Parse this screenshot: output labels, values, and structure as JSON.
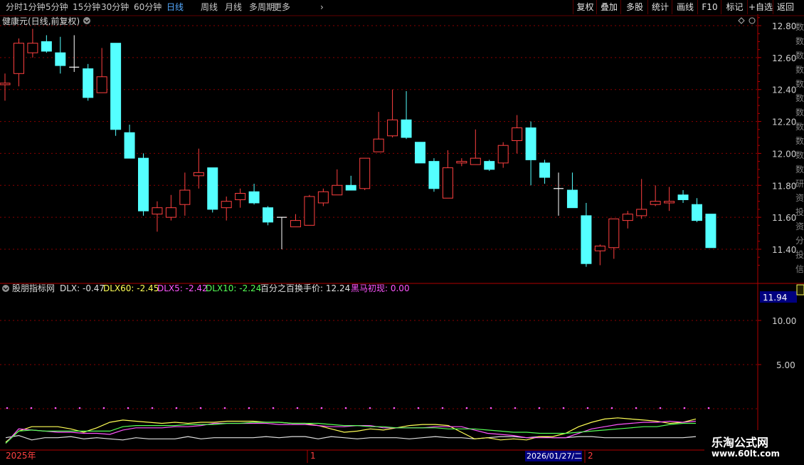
{
  "toolbar": {
    "left_items": [
      "分时",
      "1分钟",
      "5分钟",
      "15分钟",
      "30分钟",
      "60分钟",
      "日线",
      "周线",
      "月线",
      "多周期",
      "更多"
    ],
    "active_index": 6,
    "right_buttons": [
      "复权",
      "叠加",
      "多股",
      "统计",
      "画线",
      "F10",
      "标记",
      "+自选",
      "返回"
    ]
  },
  "main_panel": {
    "title": "健康元(日线,前复权)",
    "price_axis": [
      "12.80",
      "12.60",
      "12.40",
      "12.20",
      "12.00",
      "11.80",
      "11.60",
      "11.40"
    ],
    "right_edge_text": [
      "数",
      "数",
      "数",
      "数",
      "数",
      "数",
      "数",
      "数",
      "数",
      "数",
      "数",
      "研",
      "资",
      "投",
      "资",
      "分",
      "投",
      "信"
    ]
  },
  "indicator_panel": {
    "name": "股朋指标网",
    "items": [
      {
        "label": "DLX: -0.47",
        "color": "#e0e0e0"
      },
      {
        "label": "DLX60: -2.45",
        "color": "#ffff55"
      },
      {
        "label": "DLX5: -2.42",
        "color": "#ff55ff"
      },
      {
        "label": "DLX10: -2.24",
        "color": "#55ff55"
      },
      {
        "label": "百分之百换手价: 12.24",
        "color": "#e0e0e0"
      },
      {
        "label": "黑马初现: 0.00",
        "color": "#ff55ff"
      }
    ],
    "axis_highlight": "11.94",
    "axis": [
      "10.00",
      "5.00"
    ]
  },
  "bottom_axis": {
    "year": "2025年",
    "mark1": "1",
    "date": "2026/01/27/二",
    "mark2": "2"
  },
  "watermark": {
    "line1": "乐淘公式网",
    "line2": "www.60lt.com"
  },
  "chart_data": {
    "type": "candlestick",
    "ylim": [
      11.28,
      12.86
    ],
    "up_color": "#ff4040",
    "down_color": "#54ffff",
    "candles": [
      {
        "o": 12.43,
        "h": 12.5,
        "l": 12.33,
        "c": 12.44
      },
      {
        "o": 12.5,
        "h": 12.72,
        "l": 12.42,
        "c": 12.69
      },
      {
        "o": 12.63,
        "h": 12.78,
        "l": 12.6,
        "c": 12.69
      },
      {
        "o": 12.7,
        "h": 12.74,
        "l": 12.63,
        "c": 12.64
      },
      {
        "o": 12.63,
        "h": 12.73,
        "l": 12.5,
        "c": 12.55
      },
      {
        "o": 12.54,
        "h": 12.74,
        "l": 12.51,
        "c": 12.54
      },
      {
        "o": 12.53,
        "h": 12.56,
        "l": 12.33,
        "c": 12.35
      },
      {
        "o": 12.38,
        "h": 12.66,
        "l": 12.38,
        "c": 12.48
      },
      {
        "o": 12.69,
        "h": 12.69,
        "l": 12.11,
        "c": 12.15
      },
      {
        "o": 12.13,
        "h": 12.18,
        "l": 11.97,
        "c": 11.97
      },
      {
        "o": 11.97,
        "h": 12.0,
        "l": 11.61,
        "c": 11.64
      },
      {
        "o": 11.62,
        "h": 11.7,
        "l": 11.51,
        "c": 11.66
      },
      {
        "o": 11.6,
        "h": 11.74,
        "l": 11.58,
        "c": 11.66
      },
      {
        "o": 11.68,
        "h": 11.88,
        "l": 11.61,
        "c": 11.77
      },
      {
        "o": 11.86,
        "h": 12.03,
        "l": 11.78,
        "c": 11.88
      },
      {
        "o": 11.91,
        "h": 11.91,
        "l": 11.63,
        "c": 11.65
      },
      {
        "o": 11.66,
        "h": 11.73,
        "l": 11.58,
        "c": 11.7
      },
      {
        "o": 11.71,
        "h": 11.78,
        "l": 11.66,
        "c": 11.75
      },
      {
        "o": 11.76,
        "h": 11.81,
        "l": 11.68,
        "c": 11.69
      },
      {
        "o": 11.66,
        "h": 11.67,
        "l": 11.55,
        "c": 11.57
      },
      {
        "o": 11.6,
        "h": 11.6,
        "l": 11.4,
        "c": 11.6
      },
      {
        "o": 11.54,
        "h": 11.62,
        "l": 11.54,
        "c": 11.58
      },
      {
        "o": 11.55,
        "h": 11.74,
        "l": 11.55,
        "c": 11.73
      },
      {
        "o": 11.69,
        "h": 11.78,
        "l": 11.67,
        "c": 11.76
      },
      {
        "o": 11.74,
        "h": 11.9,
        "l": 11.74,
        "c": 11.8
      },
      {
        "o": 11.8,
        "h": 11.86,
        "l": 11.78,
        "c": 11.77
      },
      {
        "o": 11.78,
        "h": 11.97,
        "l": 11.77,
        "c": 11.97
      },
      {
        "o": 12.01,
        "h": 12.26,
        "l": 12.01,
        "c": 12.09
      },
      {
        "o": 12.11,
        "h": 12.4,
        "l": 12.1,
        "c": 12.21
      },
      {
        "o": 12.21,
        "h": 12.39,
        "l": 12.09,
        "c": 12.1
      },
      {
        "o": 12.07,
        "h": 12.07,
        "l": 11.94,
        "c": 11.94
      },
      {
        "o": 11.95,
        "h": 11.97,
        "l": 11.76,
        "c": 11.78
      },
      {
        "o": 11.72,
        "h": 12.02,
        "l": 11.72,
        "c": 11.91
      },
      {
        "o": 11.94,
        "h": 11.97,
        "l": 11.92,
        "c": 11.95
      },
      {
        "o": 11.93,
        "h": 12.15,
        "l": 11.93,
        "c": 11.97
      },
      {
        "o": 11.95,
        "h": 11.96,
        "l": 11.89,
        "c": 11.9
      },
      {
        "o": 11.94,
        "h": 12.07,
        "l": 11.91,
        "c": 12.05
      },
      {
        "o": 12.08,
        "h": 12.24,
        "l": 12.0,
        "c": 12.16
      },
      {
        "o": 12.16,
        "h": 12.2,
        "l": 11.8,
        "c": 11.96
      },
      {
        "o": 11.94,
        "h": 11.96,
        "l": 11.81,
        "c": 11.85
      },
      {
        "o": 11.78,
        "h": 11.88,
        "l": 11.61,
        "c": 11.78
      },
      {
        "o": 11.77,
        "h": 11.88,
        "l": 11.66,
        "c": 11.66
      },
      {
        "o": 11.61,
        "h": 11.69,
        "l": 11.29,
        "c": 11.31
      },
      {
        "o": 11.39,
        "h": 11.43,
        "l": 11.3,
        "c": 11.42
      },
      {
        "o": 11.41,
        "h": 11.59,
        "l": 11.34,
        "c": 11.59
      },
      {
        "o": 11.58,
        "h": 11.64,
        "l": 11.53,
        "c": 11.62
      },
      {
        "o": 11.61,
        "h": 11.84,
        "l": 11.59,
        "c": 11.65
      },
      {
        "o": 11.68,
        "h": 11.8,
        "l": 11.67,
        "c": 11.7
      },
      {
        "o": 11.69,
        "h": 11.79,
        "l": 11.64,
        "c": 11.7
      },
      {
        "o": 11.74,
        "h": 11.77,
        "l": 11.69,
        "c": 11.71
      },
      {
        "o": 11.68,
        "h": 11.72,
        "l": 11.57,
        "c": 11.58
      },
      {
        "o": 11.62,
        "h": 11.62,
        "l": 11.41,
        "c": 11.41
      }
    ],
    "indicator_series": [
      {
        "color": "#e0e0e0",
        "values": [
          6,
          8,
          4,
          6,
          6,
          7,
          5,
          6,
          5,
          4,
          6,
          5,
          5,
          5,
          7,
          5,
          6,
          6,
          6,
          6,
          7,
          6,
          7,
          7,
          5,
          7,
          6,
          5,
          6,
          6,
          6,
          5,
          6,
          7,
          6,
          6,
          5,
          6,
          7,
          7,
          6,
          7,
          6,
          6,
          7,
          7,
          6,
          6,
          6,
          6,
          6,
          6,
          6,
          7
        ]
      },
      {
        "color": "#ffff55",
        "values": [
          2,
          12,
          16,
          16,
          16,
          14,
          11,
          15,
          20,
          22,
          21,
          20,
          19,
          20,
          19,
          20,
          20,
          21,
          21,
          21,
          20,
          20,
          19,
          19,
          17,
          14,
          11,
          12,
          14,
          13,
          15,
          17,
          18,
          18,
          17,
          11,
          5,
          6,
          4,
          5,
          4,
          7,
          7,
          10,
          16,
          20,
          23,
          24,
          23,
          22,
          21,
          19,
          20,
          23
        ]
      },
      {
        "color": "#ff55ff",
        "values": [
          1,
          14,
          13,
          12,
          11,
          11,
          10,
          10,
          9,
          13,
          15,
          15,
          15,
          16,
          16,
          17,
          19,
          19,
          19,
          19,
          19,
          18,
          18,
          18,
          17,
          16,
          16,
          17,
          17,
          15,
          15,
          15,
          15,
          16,
          16,
          16,
          13,
          10,
          9,
          8,
          6,
          6,
          6,
          6,
          10,
          14,
          16,
          18,
          19,
          20,
          20,
          21,
          20,
          21
        ]
      },
      {
        "color": "#55ff55",
        "values": [
          1,
          12,
          13,
          12,
          12,
          12,
          12,
          12,
          12,
          16,
          17,
          17,
          17,
          17,
          18,
          18,
          18,
          19,
          19,
          20,
          20,
          20,
          19,
          19,
          19,
          18,
          17,
          17,
          16,
          16,
          15,
          15,
          15,
          15,
          14,
          14,
          14,
          13,
          12,
          11,
          11,
          10,
          10,
          10,
          11,
          12,
          13,
          14,
          15,
          16,
          16,
          18,
          19,
          19
        ]
      }
    ],
    "indicator_ylim": [
      0,
      40
    ]
  }
}
